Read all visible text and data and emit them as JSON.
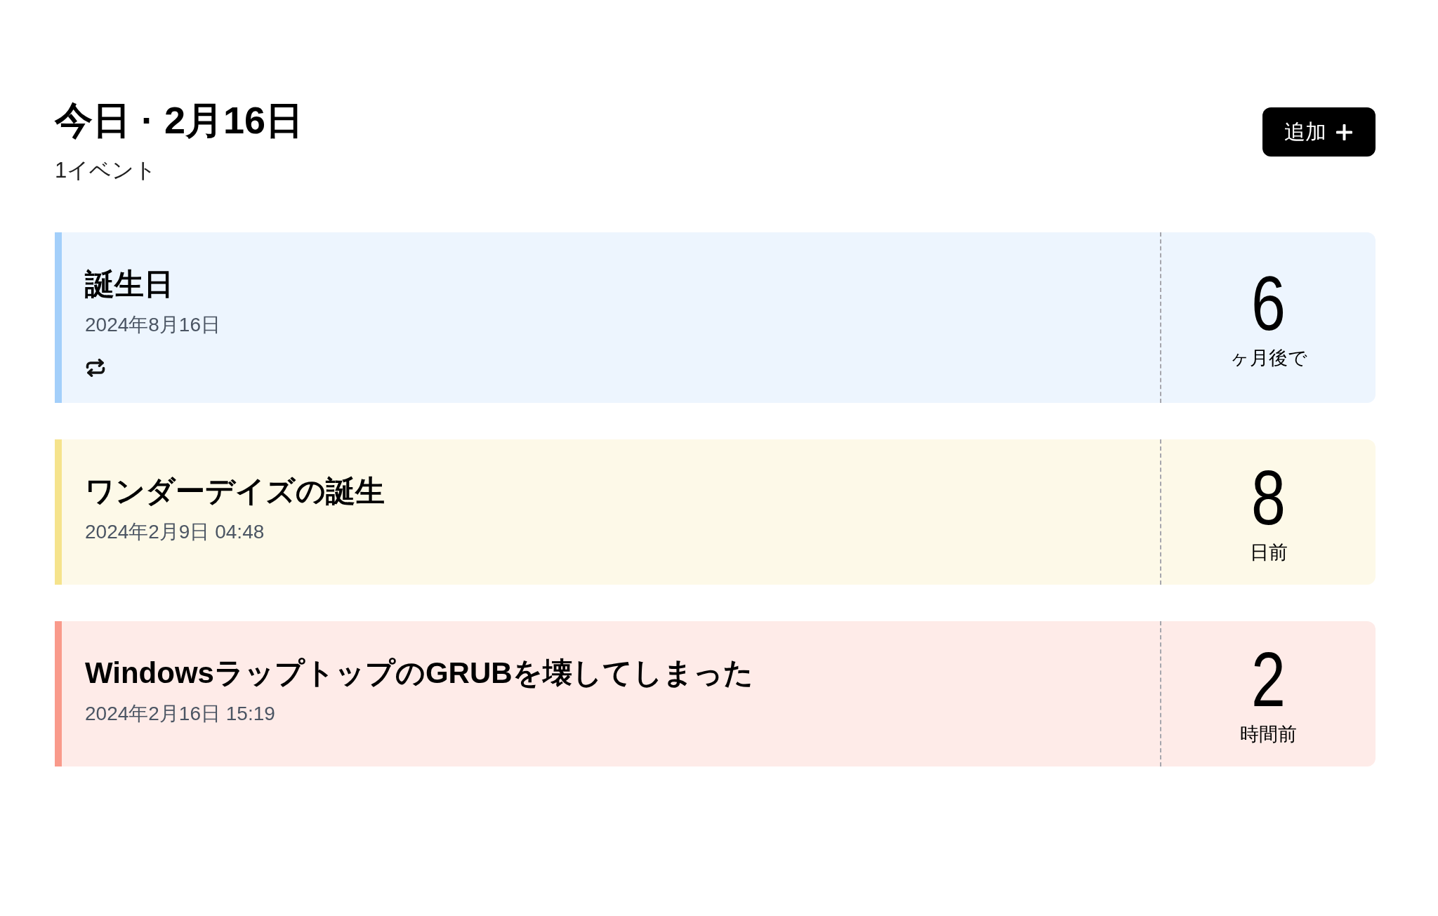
{
  "header": {
    "title": "今日 · 2月16日",
    "subtitle": "1イベント"
  },
  "add_button": {
    "label": "追加"
  },
  "events": [
    {
      "title": "誕生日",
      "date": "2024年8月16日",
      "repeat": true,
      "color": "#a3cffa",
      "count": "6",
      "unit": "ヶ月後で"
    },
    {
      "title": "ワンダーデイズの誕生",
      "date": "2024年2月9日 04:48",
      "repeat": false,
      "color": "#f5e38c",
      "count": "8",
      "unit": "日前"
    },
    {
      "title": "WindowsラップトップのGRUBを壊してしまった",
      "date": "2024年2月16日 15:19",
      "repeat": false,
      "color": "#f99a8b",
      "count": "2",
      "unit": "時間前"
    }
  ]
}
